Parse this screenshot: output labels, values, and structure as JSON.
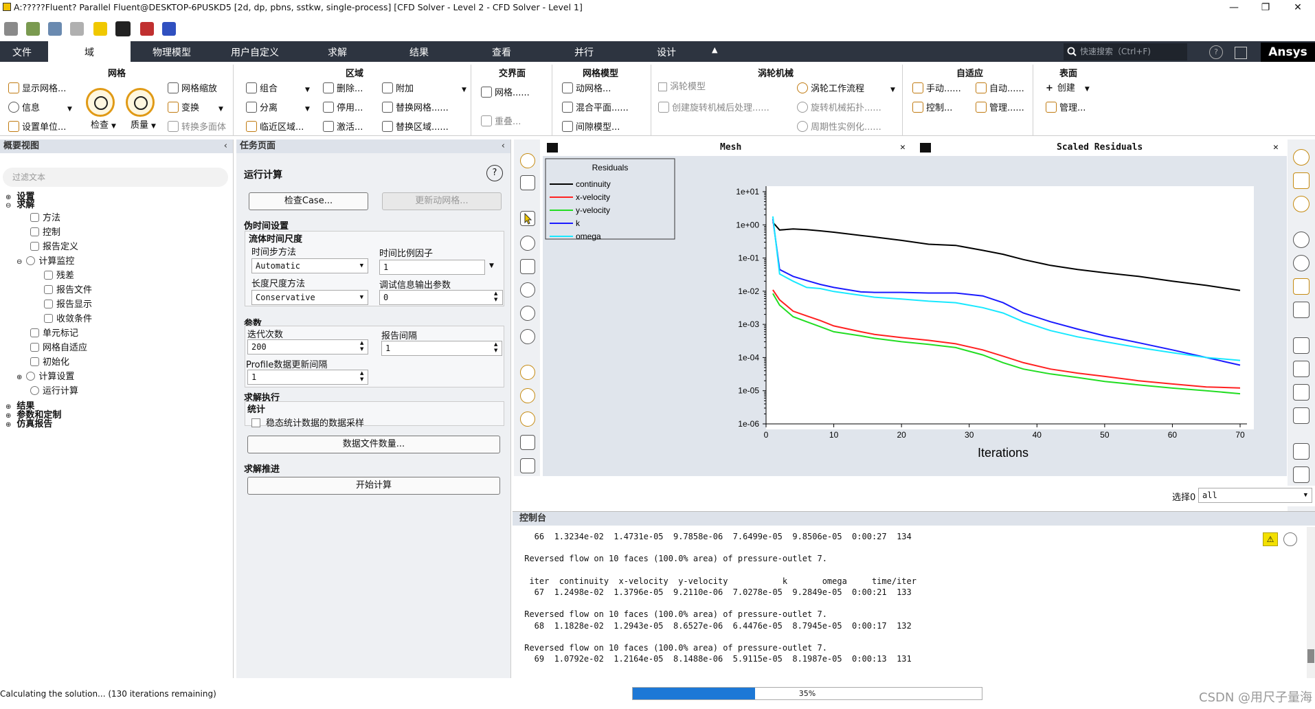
{
  "title": "A:?????Fluent? Parallel Fluent@DESKTOP-6PUSKD5  [2d, dp, pbns, sstkw, single-process] [CFD Solver - Level 2 - CFD Solver - Level 1]",
  "window_buttons": [
    "—",
    "❐",
    "✕"
  ],
  "tabs": [
    "文件",
    "域",
    "物理模型",
    "用户自定义",
    "求解",
    "结果",
    "查看",
    "并行",
    "设计"
  ],
  "search_placeholder": "快速搜索（Ctrl+F)",
  "brand": "Ansys",
  "ribbon": {
    "mesh": {
      "title": "网格",
      "show": "显示网格...",
      "info": "信息",
      "units": "设置单位...",
      "check": "检查",
      "quality": "质量",
      "scale": "网格缩放",
      "transform": "变换",
      "poly": "转换多面体"
    },
    "zones": {
      "title": "区域",
      "combine": "组合",
      "separate": "分离",
      "adjacency": "临近区域...",
      "delete": "删除...",
      "deactivate": "停用...",
      "activate": "激活...",
      "append": "附加",
      "replace_mesh": "替换网格......",
      "replace_zone": "替换区域......"
    },
    "interface": {
      "title": "交界面",
      "mesh": "网格......",
      "overlap": "重叠..."
    },
    "mesh_models": {
      "title": "网格模型",
      "dynamic": "动网格...",
      "mixing": "混合平面......",
      "gap": "间隙模型..."
    },
    "turbo": {
      "title": "涡轮机械",
      "model": "涡轮模型",
      "create_post": "创建旋转机械后处理......",
      "workflow": "涡轮工作流程",
      "topology": "旋转机械拓扑......",
      "periodic": "周期性实例化......"
    },
    "adapt": {
      "title": "自适应",
      "manual": "手动......",
      "auto": "自动......",
      "control": "控制...",
      "manage": "管理......"
    },
    "surface": {
      "title": "表面",
      "create": "创建",
      "manage": "管理..."
    }
  },
  "outline": {
    "title": "概要视图",
    "filter_placeholder": "过滤文本",
    "items": [
      "设置",
      "求解",
      "方法",
      "控制",
      "报告定义",
      "计算监控",
      "残差",
      "报告文件",
      "报告显示",
      "收敛条件",
      "单元标记",
      "网格自适应",
      "初始化",
      "计算设置",
      "运行计算",
      "结果",
      "参数和定制",
      "仿真报告"
    ]
  },
  "task": {
    "title": "任务页面",
    "heading": "运行计算",
    "check_case": "检查Case...",
    "update_mesh": "更新动网格...",
    "pseudo_section": "伪时间设置",
    "fluid_time": "流体时间尺度",
    "time_step_method_label": "时间步方法",
    "time_step_method": "Automatic",
    "time_scale_factor_label": "时间比例因子",
    "time_scale_factor": "1",
    "length_scale_label": "长度尺度方法",
    "length_scale": "Conservative",
    "verbosity_label": "调试信息输出参数",
    "verbosity": "0",
    "params_section": "参数",
    "iterations_label": "迭代次数",
    "iterations": "200",
    "report_interval_label": "报告间隔",
    "report_interval": "1",
    "profile_label": "Profile数据更新间隔",
    "profile": "1",
    "exec_section": "求解执行",
    "stats": "统计",
    "sampling": "稳态统计数据的数据采样",
    "data_file": "数据文件数量...",
    "advance_section": "求解推进",
    "start": "开始计算"
  },
  "graphics": {
    "mesh_tab": "Mesh",
    "residuals_tab": "Scaled Residuals",
    "close": "✕"
  },
  "select_label": "选择0",
  "select_value": "all",
  "console": {
    "title": "控制台",
    "lines": [
      "   66  1.3234e-02  1.4731e-05  9.7858e-06  7.6499e-05  9.8506e-05  0:00:27  134",
      "",
      " Reversed flow on 10 faces (100.0% area) of pressure-outlet 7.",
      "",
      "  iter  continuity  x-velocity  y-velocity           k       omega     time/iter",
      "   67  1.2498e-02  1.3796e-05  9.2110e-06  7.0278e-05  9.2849e-05  0:00:21  133",
      "",
      " Reversed flow on 10 faces (100.0% area) of pressure-outlet 7.",
      "   68  1.1828e-02  1.2943e-05  8.6527e-06  6.4476e-05  8.7945e-05  0:00:17  132",
      "",
      " Reversed flow on 10 faces (100.0% area) of pressure-outlet 7.",
      "   69  1.0792e-02  1.2164e-05  8.1488e-06  5.9115e-05  8.1987e-05  0:00:13  131"
    ]
  },
  "status": "Calculating the solution... (130 iterations remaining)",
  "progress": {
    "percent": 35,
    "label": "35%"
  },
  "watermark": "CSDN @用尺子量海",
  "chart_data": {
    "type": "line",
    "title": "",
    "xlabel": "Iterations",
    "ylabel": "",
    "yscale": "log",
    "xlim": [
      0,
      70
    ],
    "ylim": [
      1e-06,
      10
    ],
    "xticks": [
      "0",
      "10",
      "20",
      "30",
      "40",
      "50",
      "60",
      "70"
    ],
    "yticks": [
      "1e+01",
      "1e+00",
      "1e-01",
      "1e-02",
      "1e-03",
      "1e-04",
      "1e-05",
      "1e-06"
    ],
    "legend_title": "Residuals",
    "legend_position": "top-left",
    "grid": false,
    "x": [
      1,
      2,
      4,
      6,
      8,
      10,
      14,
      16,
      20,
      24,
      28,
      32,
      35,
      38,
      42,
      46,
      50,
      55,
      60,
      65,
      70
    ],
    "series": [
      {
        "name": "continuity",
        "color": "#000000",
        "values": [
          1.2,
          0.7,
          0.75,
          0.72,
          0.66,
          0.6,
          0.48,
          0.43,
          0.34,
          0.26,
          0.24,
          0.17,
          0.13,
          0.09,
          0.06,
          0.045,
          0.036,
          0.028,
          0.02,
          0.015,
          0.0105
        ]
      },
      {
        "name": "x-velocity",
        "color": "#ff2020",
        "values": [
          0.011,
          0.0055,
          0.0025,
          0.0018,
          0.0013,
          0.0009,
          0.0006,
          0.0005,
          0.0004,
          0.00033,
          0.00026,
          0.00017,
          0.00011,
          7e-05,
          4.5e-05,
          3.4e-05,
          2.7e-05,
          2e-05,
          1.6e-05,
          1.3e-05,
          1.21e-05
        ]
      },
      {
        "name": "y-velocity",
        "color": "#22dd22",
        "values": [
          0.0085,
          0.0038,
          0.0017,
          0.0012,
          0.00085,
          0.0006,
          0.00045,
          0.00038,
          0.0003,
          0.00025,
          0.0002,
          0.00012,
          7e-05,
          4.5e-05,
          3.2e-05,
          2.5e-05,
          1.9e-05,
          1.5e-05,
          1.2e-05,
          1e-05,
          8.1e-06
        ]
      },
      {
        "name": "k",
        "color": "#1a1aff",
        "values": [
          1.5,
          0.045,
          0.028,
          0.021,
          0.016,
          0.013,
          0.0095,
          0.0092,
          0.0092,
          0.0088,
          0.0088,
          0.0072,
          0.0045,
          0.0022,
          0.0012,
          0.00072,
          0.00045,
          0.00028,
          0.00017,
          0.0001,
          5.9e-05
        ]
      },
      {
        "name": "omega",
        "color": "#18e8ff",
        "values": [
          1.8,
          0.033,
          0.02,
          0.013,
          0.012,
          0.0098,
          0.0075,
          0.0066,
          0.0058,
          0.005,
          0.0045,
          0.0032,
          0.0022,
          0.0012,
          0.00065,
          0.00042,
          0.0003,
          0.0002,
          0.00014,
          0.0001,
          8.2e-05
        ]
      }
    ]
  }
}
